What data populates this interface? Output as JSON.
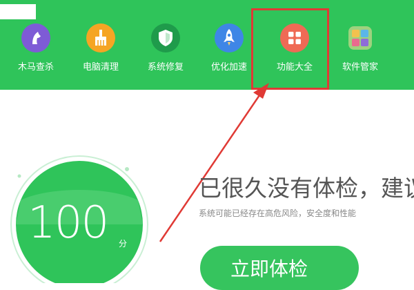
{
  "toolbar": {
    "items": [
      {
        "label": "木马查杀",
        "color": "#7e5bd6",
        "icon": "horse-icon"
      },
      {
        "label": "电脑清理",
        "color": "#f5a524",
        "icon": "broom-icon"
      },
      {
        "label": "系统修复",
        "color": "#1f9b4b",
        "icon": "shield-icon"
      },
      {
        "label": "优化加速",
        "color": "#3f86e6",
        "icon": "rocket-icon"
      },
      {
        "label": "功能大全",
        "color": "#ef6a55",
        "icon": "grid-icon"
      },
      {
        "label": "软件管家",
        "color": "#8acb6a",
        "icon": "software-grid-icon"
      }
    ]
  },
  "score": {
    "value": "100",
    "unit": "分"
  },
  "message": {
    "headline": "已很久没有体检，建议",
    "subline": "系统可能已经存在高危风险，安全度和性能"
  },
  "actions": {
    "check_now": "立即体检"
  },
  "colors": {
    "brand_green": "#2fc45a",
    "highlight_red": "#e03a35",
    "button_green": "#36c45e"
  }
}
